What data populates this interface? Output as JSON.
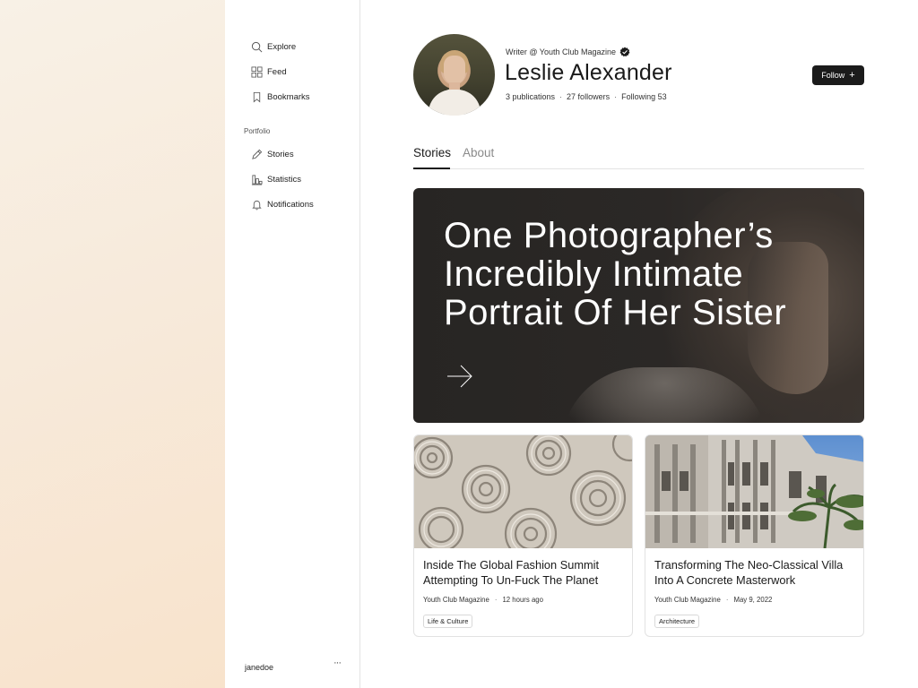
{
  "sidebar": {
    "nav": [
      {
        "label": "Explore",
        "icon": "search-icon"
      },
      {
        "label": "Feed",
        "icon": "feed-grid-icon"
      },
      {
        "label": "Bookmarks",
        "icon": "bookmark-icon"
      }
    ],
    "section_label": "Portfolio",
    "portfolio": [
      {
        "label": "Stories",
        "icon": "pen-icon"
      },
      {
        "label": "Statistics",
        "icon": "bar-chart-icon"
      },
      {
        "label": "Notifications",
        "icon": "bell-icon"
      }
    ],
    "user": {
      "name": "janedoe",
      "more_label": "···"
    }
  },
  "profile": {
    "writer_line": "Writer @ Youth Club Magazine",
    "verified_icon": "verified-badge-icon",
    "name": "Leslie Alexander",
    "stats": {
      "publications": "3 publications",
      "followers": "27 followers",
      "following": "Following 53"
    },
    "follow_label": "Follow",
    "follow_icon": "plus-icon"
  },
  "tabs": [
    {
      "label": "Stories",
      "active": true
    },
    {
      "label": "About",
      "active": false
    }
  ],
  "hero": {
    "title": "One Photographer’s Incredibly Intimate Portrait Of Her Sister",
    "arrow_icon": "arrow-right-icon"
  },
  "cards": [
    {
      "title": "Inside The Global Fashion Summit Attempting To Un-Fuck The Planet",
      "publication": "Youth Club Magazine",
      "time": "12 hours ago",
      "tag": "Life & Culture"
    },
    {
      "title": "Transforming The Neo-Classical Villa Into A Concrete Masterwork",
      "publication": "Youth Club Magazine",
      "time": "May 9, 2022",
      "tag": "Architecture"
    }
  ],
  "colors": {
    "accent_dark": "#1b1b1b",
    "left_bg": "#f8e6d0",
    "hero_bg": "#2a2725"
  }
}
